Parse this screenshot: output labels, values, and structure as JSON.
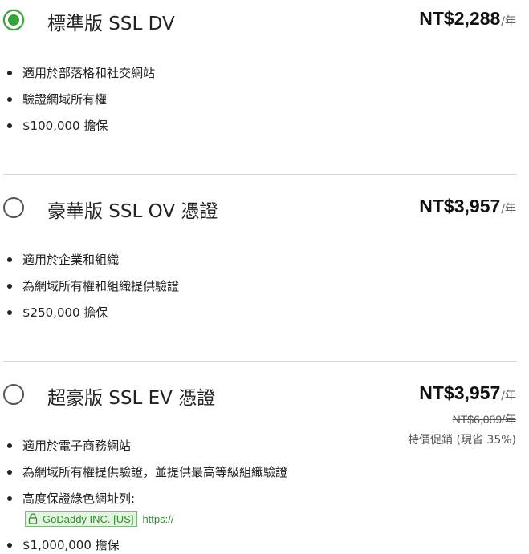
{
  "plans": [
    {
      "title": "標準版 SSL DV",
      "selected": true,
      "price": "NT$2,288",
      "unit": "/年",
      "features": [
        "適用於部落格和社交網站",
        "驗證網域所有權",
        "$100,000 擔保"
      ]
    },
    {
      "title": "豪華版 SSL OV 憑證",
      "selected": false,
      "price": "NT$3,957",
      "unit": "/年",
      "features": [
        "適用於企業和組織",
        "為網域所有權和組織提供驗證",
        "$250,000 擔保"
      ]
    },
    {
      "title": "超豪版 SSL EV 憑證",
      "selected": false,
      "price": "NT$3,957",
      "unit": "/年",
      "old_price": "NT$6,089/年",
      "sale_text": "特價促銷 (現省 35%)",
      "features": [
        "適用於電子商務網站",
        "為網域所有權提供驗證，並提供最高等級組織驗證",
        "高度保證綠色網址列:",
        "$1,000,000 擔保"
      ],
      "ev_badge": "GoDaddy INC. [US]",
      "ev_url": "https://"
    }
  ],
  "colors": {
    "selected_green": "#3aa23a",
    "ev_green": "#2f8a2f",
    "divider": "#d6d6d6"
  },
  "icons": {
    "radio_selected": "radio-selected-icon",
    "radio_empty": "radio-empty-icon",
    "ev_lock": "lock-icon"
  }
}
